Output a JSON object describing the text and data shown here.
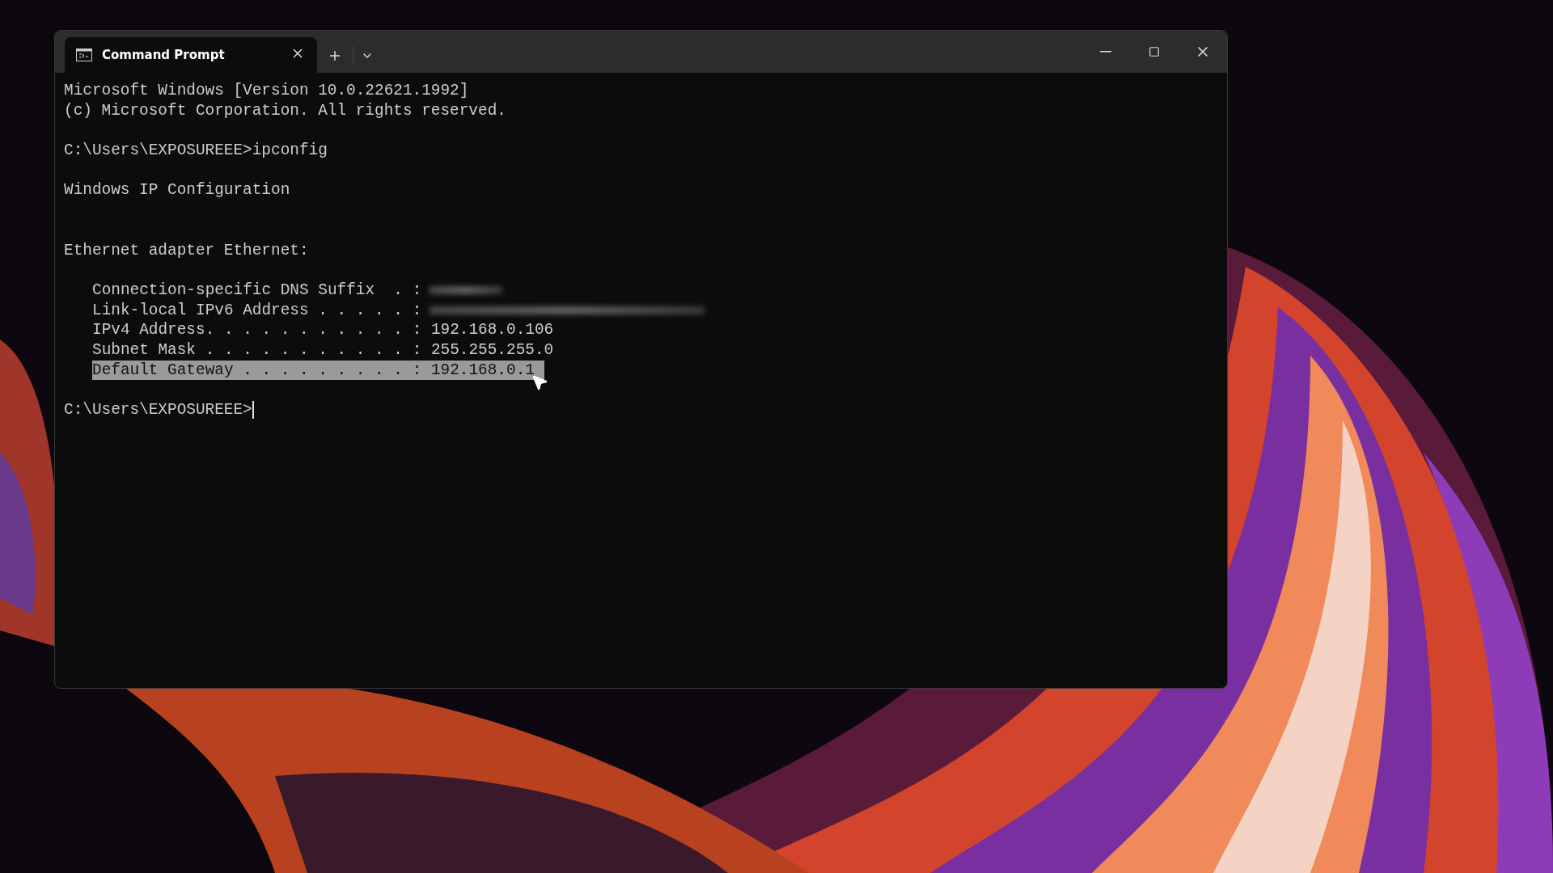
{
  "window": {
    "tabs": [
      {
        "title": "Command Prompt",
        "selected": true
      }
    ]
  },
  "terminal": {
    "lines": [
      {
        "kind": "text",
        "text": "Microsoft Windows [Version 10.0.22621.1992]"
      },
      {
        "kind": "text",
        "text": "(c) Microsoft Corporation. All rights reserved."
      },
      {
        "kind": "blank"
      },
      {
        "kind": "text",
        "text": "C:\\Users\\EXPOSUREEE>ipconfig"
      },
      {
        "kind": "blank"
      },
      {
        "kind": "text",
        "text": "Windows IP Configuration"
      },
      {
        "kind": "blank"
      },
      {
        "kind": "blank"
      },
      {
        "kind": "text",
        "text": "Ethernet adapter Ethernet:"
      },
      {
        "kind": "blank"
      },
      {
        "kind": "short_redacted",
        "label": "Connection-specific DNS Suffix  . :",
        "selected": false
      },
      {
        "kind": "long_redacted",
        "label": "Link-local IPv6 Address . . . . . :",
        "selected": false
      },
      {
        "kind": "field",
        "label": "IPv4 Address. . . . . . . . . . . :",
        "value": "192.168.0.106",
        "selected": false
      },
      {
        "kind": "field",
        "label": "Subnet Mask . . . . . . . . . . . :",
        "value": "255.255.255.0",
        "selected": false
      },
      {
        "kind": "field",
        "label": "Default Gateway . . . . . . . . . :",
        "value": "192.168.0.1",
        "selected": true
      },
      {
        "kind": "blank"
      },
      {
        "kind": "prompt",
        "text": "C:\\Users\\EXPOSUREEE>",
        "cursor": true
      }
    ]
  }
}
